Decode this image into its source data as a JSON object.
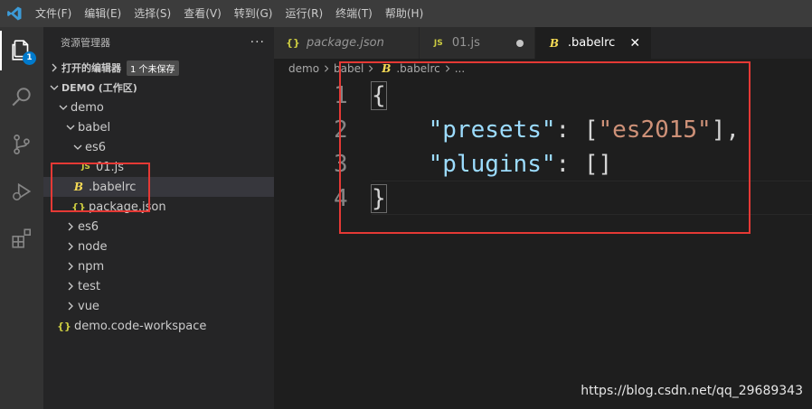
{
  "menu": {
    "items": [
      "文件(F)",
      "编辑(E)",
      "选择(S)",
      "查看(V)",
      "转到(G)",
      "运行(R)",
      "终端(T)",
      "帮助(H)"
    ]
  },
  "activity": {
    "explorer_badge": "1"
  },
  "sidebar": {
    "title": "资源管理器",
    "more": "···",
    "open_editors_label": "打开的编辑器",
    "open_editors_badge": "1 个未保存",
    "workspace_label": "DEMO (工作区)",
    "tree": [
      {
        "label": "demo",
        "depth": 1,
        "kind": "folder-open"
      },
      {
        "label": "babel",
        "depth": 2,
        "kind": "folder-open"
      },
      {
        "label": "es6",
        "depth": 3,
        "kind": "folder-open"
      },
      {
        "label": "01.js",
        "depth": 4,
        "kind": "js"
      },
      {
        "label": ".babelrc",
        "depth": 3,
        "kind": "babel",
        "selected": true
      },
      {
        "label": "package.json",
        "depth": 3,
        "kind": "json"
      },
      {
        "label": "es6",
        "depth": 2,
        "kind": "folder-closed"
      },
      {
        "label": "node",
        "depth": 2,
        "kind": "folder-closed"
      },
      {
        "label": "npm",
        "depth": 2,
        "kind": "folder-closed"
      },
      {
        "label": "test",
        "depth": 2,
        "kind": "folder-closed"
      },
      {
        "label": "vue",
        "depth": 2,
        "kind": "folder-closed"
      },
      {
        "label": "demo.code-workspace",
        "depth": 1,
        "kind": "json"
      }
    ],
    "icon_text": {
      "js": "JS",
      "json": "{}",
      "babel": "B"
    }
  },
  "tabs": [
    {
      "label": "package.json",
      "icon": "{}",
      "italic": true
    },
    {
      "label": "01.js",
      "icon": "JS",
      "modified": true
    },
    {
      "label": ".babelrc",
      "icon": "B",
      "active": true,
      "close": "✕"
    }
  ],
  "breadcrumb": {
    "parts": [
      "demo",
      "babel",
      ".babelrc",
      "..."
    ]
  },
  "code": {
    "line_numbers": [
      "1",
      "2",
      "3",
      "4"
    ],
    "lines": [
      [
        {
          "t": "{",
          "c": "bracket"
        }
      ],
      [
        {
          "t": "    ",
          "c": "punc"
        },
        {
          "t": "\"presets\"",
          "c": "key"
        },
        {
          "t": ": [",
          "c": "punc"
        },
        {
          "t": "\"es2015\"",
          "c": "str"
        },
        {
          "t": "],",
          "c": "punc"
        }
      ],
      [
        {
          "t": "    ",
          "c": "punc"
        },
        {
          "t": "\"plugins\"",
          "c": "key"
        },
        {
          "t": ": []",
          "c": "punc"
        }
      ],
      [
        {
          "t": "}",
          "c": "bracket"
        }
      ]
    ]
  },
  "watermark": "https://blog.csdn.net/qq_29689343",
  "colors": {
    "accent": "#007acc",
    "highlight": "#e53935"
  }
}
